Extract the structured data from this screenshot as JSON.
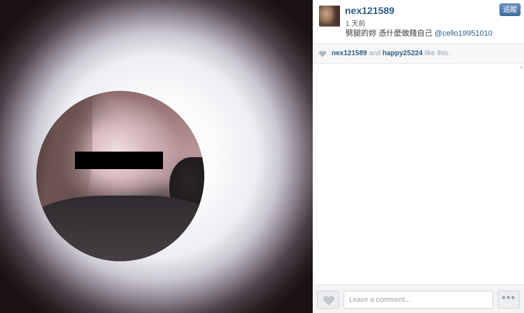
{
  "post": {
    "username": "nex121589",
    "time": "1 天前",
    "caption_text": "劈腿的妳 憑什麼做賤自己",
    "caption_mention": "@cello19951010",
    "follow_label": "追蹤"
  },
  "likes": {
    "heart_icon": "heart-icon",
    "liker1": "nex121589",
    "joiner": "and",
    "liker2": "happy25224",
    "suffix": "like this."
  },
  "comment_bar": {
    "like_icon": "heart-icon",
    "input_placeholder": "Leave a comment...",
    "more_label": "•••"
  },
  "colors": {
    "username_blue": "#2d5c86",
    "follow_button": "#4f7fb0"
  }
}
